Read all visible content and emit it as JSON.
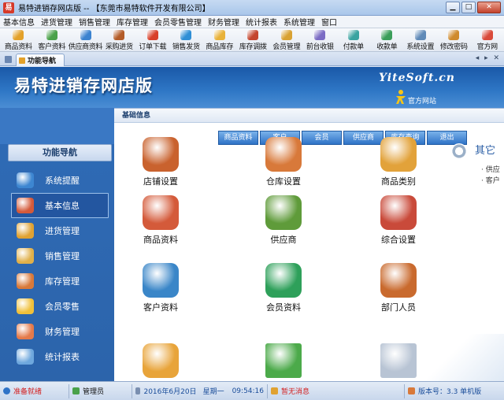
{
  "window": {
    "title": "易特进销存网店版 -- 【东莞市易特软件开发有限公司】",
    "icon_glyph": "易"
  },
  "menu": [
    "基本信息",
    "进货管理",
    "销售管理",
    "库存管理",
    "会员零售管理",
    "财务管理",
    "统计报表",
    "系统管理",
    "窗口"
  ],
  "toolbar": [
    {
      "label": "商品资料",
      "color": "#e3a12a"
    },
    {
      "label": "客户资料",
      "color": "#4aa14a"
    },
    {
      "label": "供应商资料",
      "color": "#3b83d0"
    },
    {
      "label": "采购进货",
      "color": "#b35c28"
    },
    {
      "label": "订单下载",
      "color": "#d8402a"
    },
    {
      "label": "销售发货",
      "color": "#2f8fd6"
    },
    {
      "label": "商品库存",
      "color": "#e8b23a"
    },
    {
      "label": "库存调拨",
      "color": "#c4452e"
    },
    {
      "label": "会员管理",
      "color": "#d9a233"
    },
    {
      "label": "前台收银",
      "color": "#7b6cc4"
    },
    {
      "label": "付款单",
      "color": "#39a3a0"
    },
    {
      "label": "收款单",
      "color": "#3b9e5a"
    },
    {
      "label": "系统设置",
      "color": "#5f8ab8"
    },
    {
      "label": "修改密码",
      "color": "#cf8a2c"
    },
    {
      "label": "官方网",
      "color": "#d94a3a"
    }
  ],
  "tab": {
    "label": "功能导航"
  },
  "banner": {
    "title": "易特进销存网店版",
    "brand": "YiteSoft.cn",
    "site_link": "官方网站"
  },
  "leftnav": {
    "title": "功能导航",
    "items": [
      {
        "label": "系统提醒",
        "icon": "info-icon",
        "color": "#3d86d1"
      },
      {
        "label": "基本信息",
        "icon": "blocks-icon",
        "color": "#d45a3a"
      },
      {
        "label": "进货管理",
        "icon": "box-in-icon",
        "color": "#e0a232"
      },
      {
        "label": "销售管理",
        "icon": "box-out-icon",
        "color": "#e0b04a"
      },
      {
        "label": "库存管理",
        "icon": "warehouse-icon",
        "color": "#d8793a"
      },
      {
        "label": "会员零售",
        "icon": "member-icon",
        "color": "#f0c03a"
      },
      {
        "label": "财务管理",
        "icon": "finance-icon",
        "color": "#e47a4a"
      },
      {
        "label": "统计报表",
        "icon": "chart-icon",
        "color": "#6ea7dd"
      }
    ],
    "active_index": 1
  },
  "main": {
    "header": "基础信息",
    "subnav": [
      "商品资料",
      "客户",
      "会员",
      "供应商",
      "库存查询",
      "退出"
    ],
    "side": {
      "title": "其它",
      "items": [
        "· 供应",
        "· 客户"
      ]
    },
    "modules": [
      {
        "label": "店铺设置",
        "icon": "shop-icon",
        "color": "#c9622e"
      },
      {
        "label": "仓库设置",
        "icon": "warehouse-icon",
        "color": "#d8793a"
      },
      {
        "label": "商品类别",
        "icon": "category-icon",
        "color": "#e2a23a"
      },
      {
        "label": "商品资料",
        "icon": "blocks-icon",
        "color": "#d45a3a"
      },
      {
        "label": "供应商",
        "icon": "supplier-icon",
        "color": "#5f9b3a"
      },
      {
        "label": "综合设置",
        "icon": "tools-icon",
        "color": "#c94a3a"
      },
      {
        "label": "客户资料",
        "icon": "customers-icon",
        "color": "#3a86c8"
      },
      {
        "label": "会员资料",
        "icon": "member-add-icon",
        "color": "#2ea05a"
      },
      {
        "label": "部门人员",
        "icon": "staff-icon",
        "color": "#c96a2e"
      },
      {
        "label": "",
        "icon": "money-icon",
        "color": "#e8a43a"
      },
      {
        "label": "",
        "icon": "download-icon",
        "color": "#4caa4a"
      },
      {
        "label": "",
        "icon": "mail-icon",
        "color": "#b8c4d4"
      }
    ]
  },
  "status": {
    "ready": "准备就绪",
    "user": "管理员",
    "date": "2016年6月20日",
    "weekday": "星期一",
    "time": "09:54:16",
    "message": "暂无消息",
    "version": "版本号：3.3 单机版"
  }
}
